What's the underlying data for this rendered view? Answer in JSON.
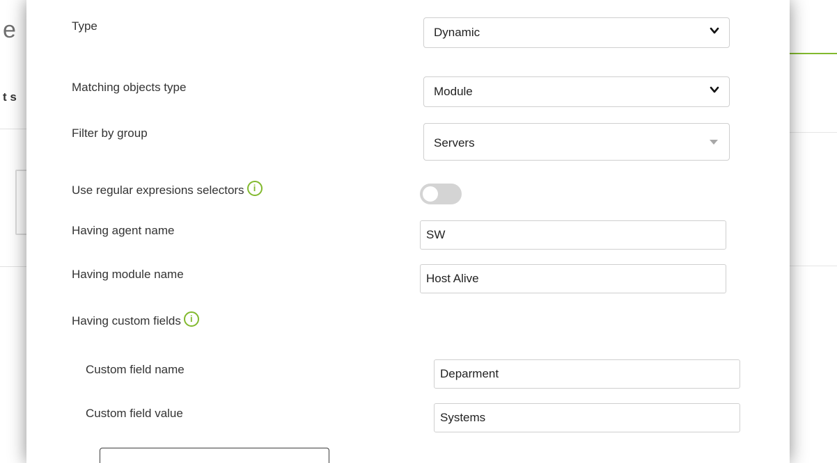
{
  "background": {
    "title_fragment": "e",
    "subtitle_fragment": "t s"
  },
  "form": {
    "type": {
      "label": "Type",
      "value": "Dynamic"
    },
    "matching_objects_type": {
      "label": "Matching objects type",
      "value": "Module"
    },
    "filter_by_group": {
      "label": "Filter by group",
      "value": "Servers"
    },
    "regex_selectors": {
      "label": "Use regular expresions selectors",
      "enabled": false
    },
    "agent_name": {
      "label": "Having agent name",
      "value": "SW"
    },
    "module_name": {
      "label": "Having module name",
      "value": "Host Alive"
    },
    "custom_fields": {
      "label": "Having custom fields",
      "field_name": {
        "label": "Custom field name",
        "value": "Deparment"
      },
      "field_value": {
        "label": "Custom field value",
        "value": "Systems"
      }
    }
  },
  "icons": {
    "info": "i",
    "select_arrow": "chevron-down-icon",
    "combo_arrow": "caret-down-icon"
  },
  "colors": {
    "accent": "#82b92e",
    "toggle_off": "#d4d4d4",
    "border": "#cfcfcf"
  }
}
